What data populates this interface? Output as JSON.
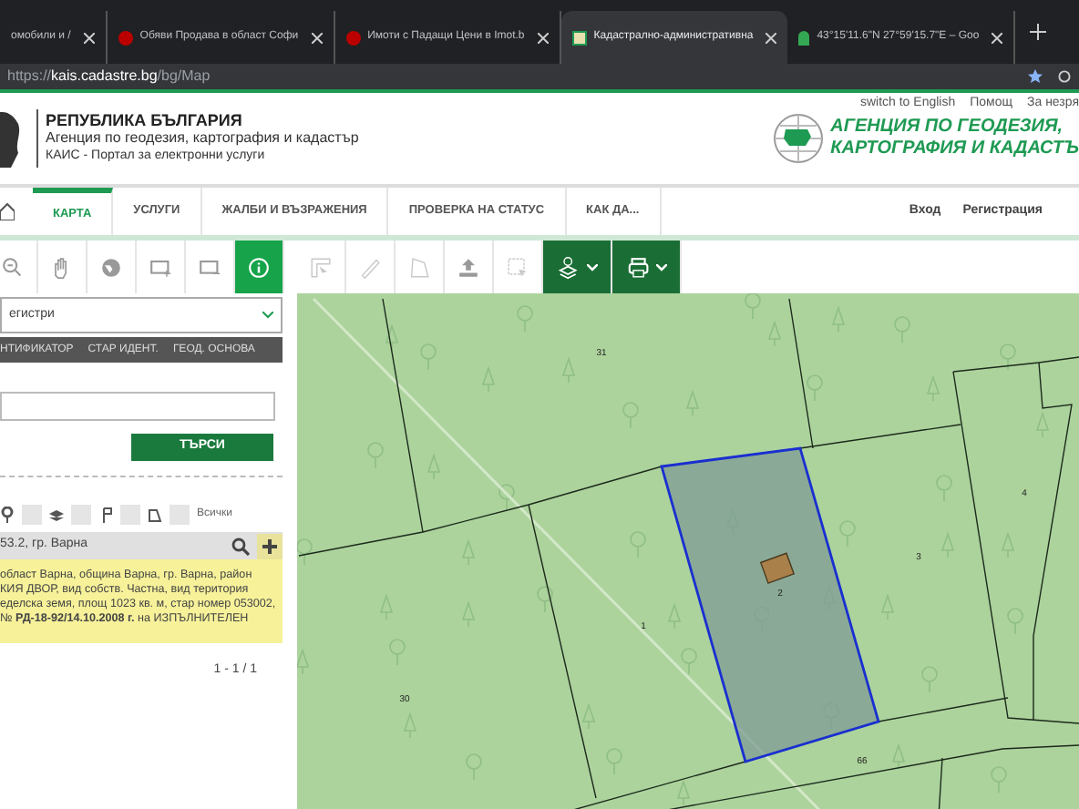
{
  "browser_tabs": [
    {
      "title": "омобили и /",
      "selected": false
    },
    {
      "title": "Обяви Продава в област Софи",
      "selected": false
    },
    {
      "title": "Имоти с Падащи Цени в Imot.b",
      "selected": false
    },
    {
      "title": "Кадастрално-административна",
      "selected": true
    },
    {
      "title": "43°15'11.6\"N 27°59'15.7\"E – Goo",
      "selected": false
    }
  ],
  "address_bar": {
    "scheme": "https://",
    "host": "kais.cadastre.bg",
    "path": "/bg/Map"
  },
  "top_links": [
    "switch to English",
    "Помощ",
    "За незря"
  ],
  "header": {
    "title": "РЕПУБЛИКА БЪЛГАРИЯ",
    "subtitle": "Агенция по геодезия, картография и кадастър",
    "portal": "КАИС - Портал за електронни услуги",
    "agency_lines": [
      "АГЕНЦИЯ ПО ГЕОДЕЗИЯ,",
      "КАРТОГРАФИЯ И КАДАСТЪ"
    ]
  },
  "nav": [
    {
      "label": "КАРТА",
      "selected": true
    },
    {
      "label": "УСЛУГИ",
      "selected": false
    },
    {
      "label": "ЖАЛБИ И ВЪЗРАЖЕНИЯ",
      "selected": false
    },
    {
      "label": "ПРОВЕРКА НА СТАТУС",
      "selected": false
    },
    {
      "label": "КАК ДА...",
      "selected": false
    }
  ],
  "account_links": [
    "Вход",
    "Регистрация"
  ],
  "tools": [
    {
      "kind": "zoom-out",
      "selected": false
    },
    {
      "kind": "pan",
      "selected": false
    },
    {
      "kind": "globe",
      "selected": false
    },
    {
      "kind": "box-plus",
      "selected": false
    },
    {
      "kind": "box-minus",
      "selected": false
    },
    {
      "kind": "info",
      "selected": true
    },
    {
      "kind": "ruler",
      "selected": false,
      "disabled": true
    },
    {
      "kind": "measure",
      "selected": false,
      "disabled": true
    },
    {
      "kind": "area",
      "selected": false,
      "disabled": true
    },
    {
      "kind": "upload",
      "selected": false,
      "disabled": false
    },
    {
      "kind": "select",
      "selected": false,
      "disabled": true
    },
    {
      "kind": "layers-menu",
      "selected": false
    },
    {
      "kind": "print-menu",
      "selected": false
    }
  ],
  "search_panel": {
    "register_select": "егистри",
    "search_tabs": [
      "НТИФИКАТОР",
      "СТАР ИДЕНТ.",
      "ГЕОД. ОСНОВА"
    ],
    "search_button": "ТЪРСИ",
    "layer_toggles": [
      {
        "checked": false
      },
      {
        "checked": false
      },
      {
        "checked": false
      },
      {
        "checked": false
      }
    ],
    "layer_filter_all": "Всички",
    "result": {
      "title": "53.2, гр. Варна",
      "description": "област Варна, община Варна, гр. Варна, район\nКИЯ ДВОР, вид собств. Частна, вид територия\nеделска земя, площ 1023 кв. м, стар номер 053002,\n№ **РД-18-92/14.10.2008 г.** на ИЗПЪЛНИТЕЛЕН"
    },
    "pagination": "1 - 1 / 1"
  },
  "map": {
    "parcel_numbers": [
      "31",
      "4",
      "3",
      "2",
      "1",
      "30",
      "66"
    ]
  }
}
